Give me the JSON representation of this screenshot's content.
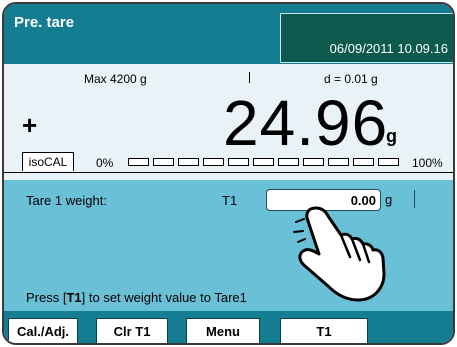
{
  "header": {
    "title": "Pre. tare",
    "datetime": "06/09/2011 10.09.16"
  },
  "weighing": {
    "max": "Max 4200 g",
    "divider": "|",
    "resolution": "d = 0.01 g",
    "sign": "+",
    "value": "24.96",
    "unit": "g",
    "isocal_tab": "isoCAL",
    "range_start": "0%",
    "range_end": "100%",
    "range_fill_fraction": 0.006
  },
  "tare": {
    "label": "Tare 1 weight:",
    "field_label": "T1",
    "value": "0.00",
    "unit": "g",
    "hint_prefix": "Press [",
    "hint_key": "T1",
    "hint_suffix": "] to set weight value to Tare1"
  },
  "softkeys": [
    "Cal./Adj.",
    "Clr T1",
    "Menu",
    "T1"
  ],
  "icons": {
    "pointer": "hand-pointer-icon"
  },
  "colors": {
    "header_bg": "#157d92",
    "datebox_bg": "#0c5a4e",
    "weigh_bg": "#e9f3f7",
    "info_bg": "#6ac0d7"
  }
}
